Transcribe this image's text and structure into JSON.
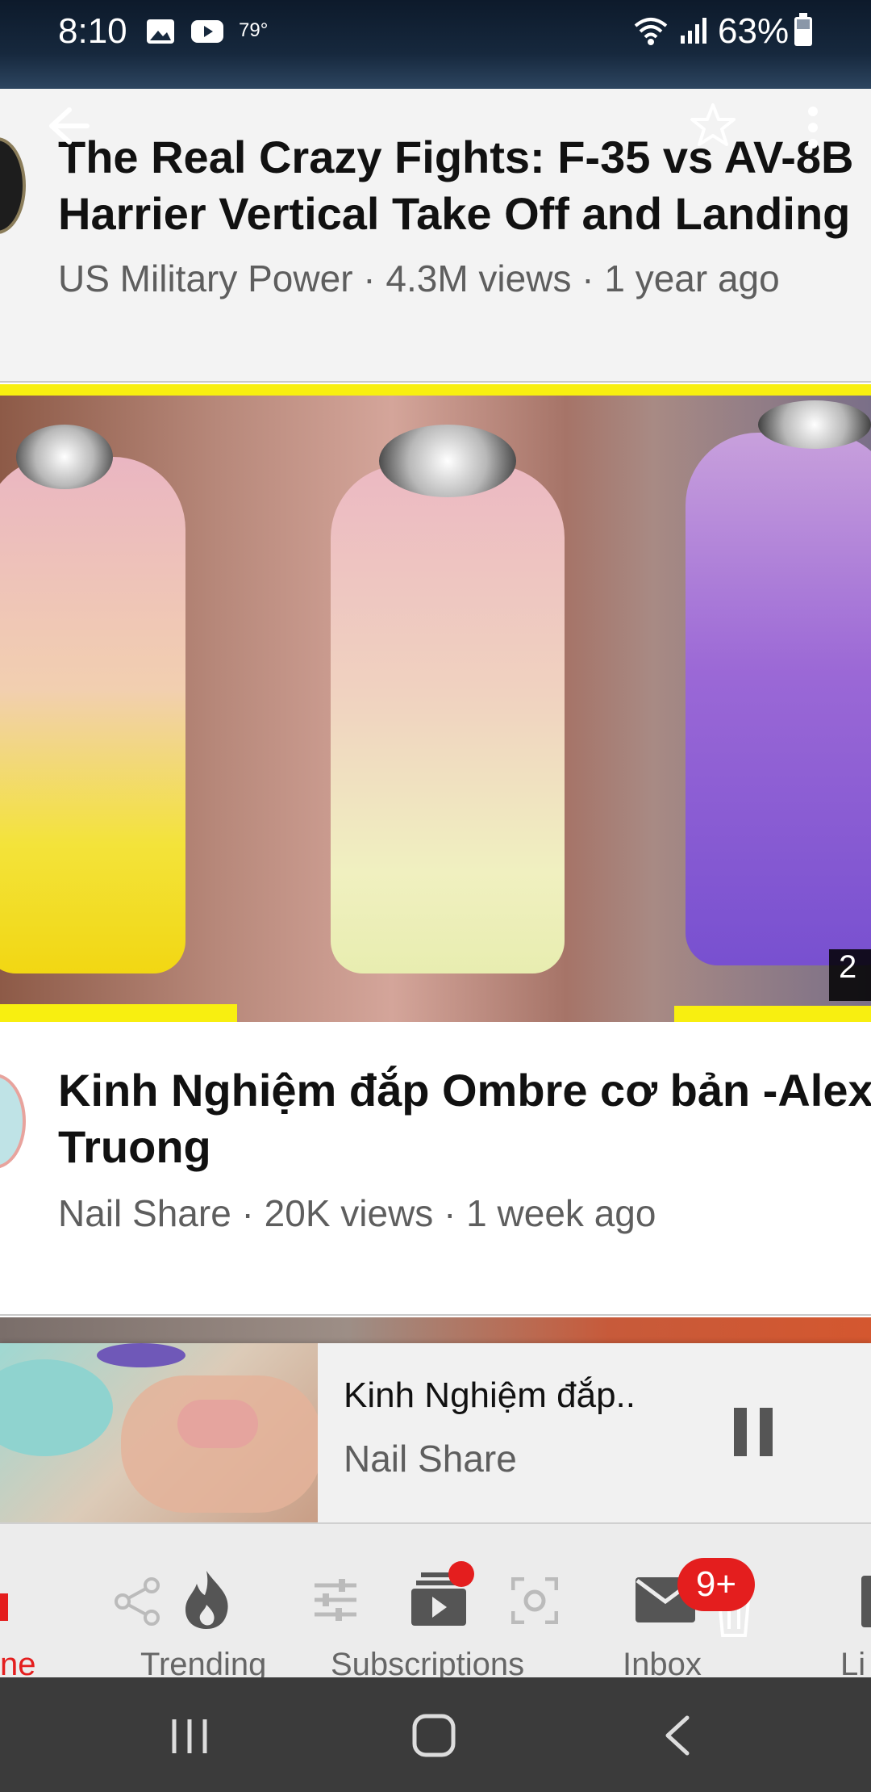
{
  "status_bar": {
    "time": "8:10",
    "temperature": "79°",
    "battery": "63%",
    "icons": [
      "image-icon",
      "youtube-icon",
      "wifi-icon",
      "signal-icon",
      "battery-icon"
    ]
  },
  "top_actions": {
    "icons": [
      "back-arrow-icon",
      "star-icon",
      "more-vert-icon"
    ]
  },
  "videos": [
    {
      "title_line1": "The Real Crazy Fights: F-35 vs AV-8B",
      "title_line2": "Harrier Vertical Take Off and Landing",
      "meta": "US Military Power · 4.3M views · 1 year ago"
    },
    {
      "duration": "2",
      "title_line1": "Kinh Nghiệm đắp Ombre cơ bản -Alex",
      "title_line2": "Truong",
      "meta": "Nail Share · 20K views · 1 week ago"
    }
  ],
  "mini_player": {
    "title": "Kinh Nghiệm đắp..",
    "channel": "Nail Share"
  },
  "bottom_nav": {
    "items": [
      {
        "label": "ne",
        "icon": "home-icon"
      },
      {
        "label": "Trending",
        "icon": "flame-icon"
      },
      {
        "label": "Subscriptions",
        "icon": "subscriptions-icon"
      },
      {
        "label": "Inbox",
        "icon": "mail-icon"
      },
      {
        "label": "Li",
        "icon": "library-icon"
      }
    ],
    "inbox_badge": "9+",
    "overlay_icons": [
      "share-icon",
      "sliders-icon",
      "screenshot-icon",
      "trash-icon"
    ]
  },
  "colors": {
    "accent": "#e41e1e",
    "nav_bg": "#ececec",
    "system_nav_bg": "#3b3b3b"
  }
}
